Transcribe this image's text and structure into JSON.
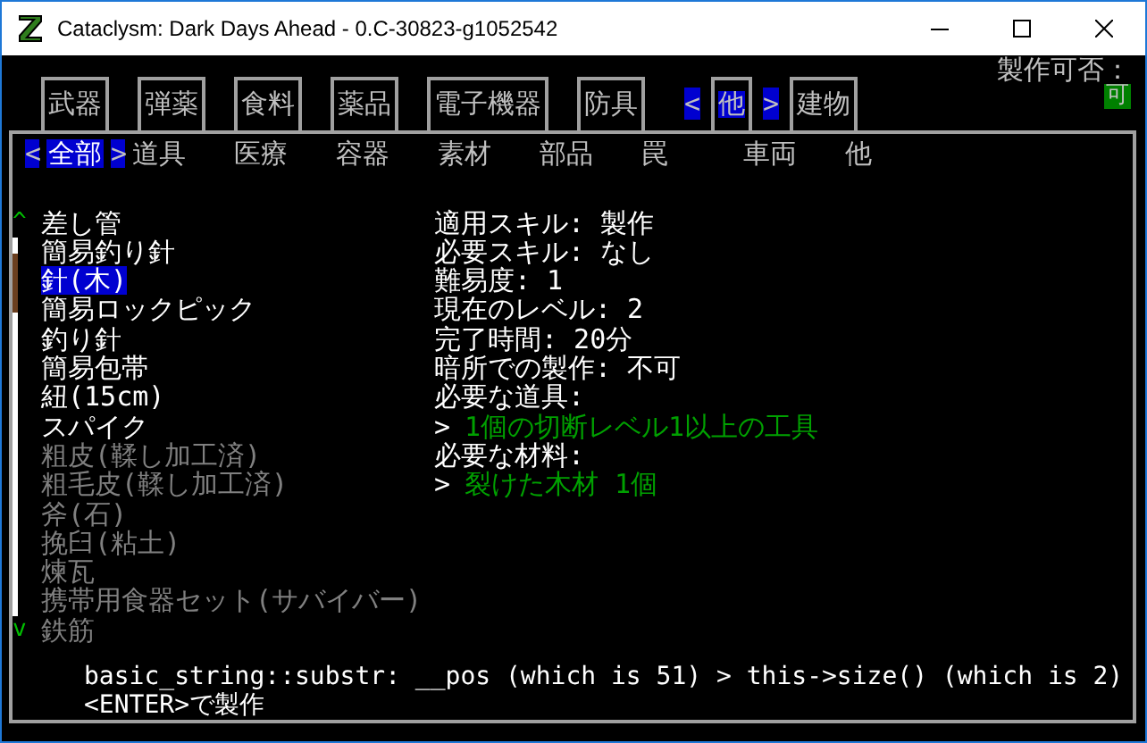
{
  "window": {
    "title": "Cataclysm: Dark Days Ahead - 0.C-30823-g1052542"
  },
  "tabs": {
    "left_arrow": "<",
    "right_arrow": ">",
    "items": [
      {
        "label": "武器",
        "selected": false
      },
      {
        "label": "弾薬",
        "selected": false
      },
      {
        "label": "食料",
        "selected": false
      },
      {
        "label": "薬品",
        "selected": false
      },
      {
        "label": "電子機器",
        "selected": false
      },
      {
        "label": "防具",
        "selected": false
      },
      {
        "label": "他",
        "selected": true
      },
      {
        "label": "建物",
        "selected": false
      }
    ]
  },
  "craft_status": {
    "label": "製作可否：",
    "value": "可"
  },
  "subtabs": {
    "left_arrow": "<",
    "right_arrow": ">",
    "items": [
      {
        "label": "全部",
        "selected": true
      },
      {
        "label": "道具",
        "selected": false
      },
      {
        "label": "医療",
        "selected": false
      },
      {
        "label": "容器",
        "selected": false
      },
      {
        "label": "素材",
        "selected": false
      },
      {
        "label": "部品",
        "selected": false
      },
      {
        "label": "罠",
        "selected": false
      },
      {
        "label": "車両",
        "selected": false
      },
      {
        "label": "他",
        "selected": false
      }
    ]
  },
  "scroll": {
    "up": "^",
    "down": "v"
  },
  "recipes": [
    {
      "name": "差し管",
      "available": true,
      "selected": false
    },
    {
      "name": "簡易釣り針",
      "available": true,
      "selected": false
    },
    {
      "name": "針(木)",
      "available": true,
      "selected": true
    },
    {
      "name": "簡易ロックピック",
      "available": true,
      "selected": false
    },
    {
      "name": "釣り針",
      "available": true,
      "selected": false
    },
    {
      "name": "簡易包帯",
      "available": true,
      "selected": false
    },
    {
      "name": "紐(15cm)",
      "available": true,
      "selected": false
    },
    {
      "name": "スパイク",
      "available": true,
      "selected": false
    },
    {
      "name": "粗皮(鞣し加工済)",
      "available": false,
      "selected": false
    },
    {
      "name": "粗毛皮(鞣し加工済)",
      "available": false,
      "selected": false
    },
    {
      "name": "斧(石)",
      "available": false,
      "selected": false
    },
    {
      "name": "挽臼(粘土)",
      "available": false,
      "selected": false
    },
    {
      "name": "煉瓦",
      "available": false,
      "selected": false
    },
    {
      "name": "携帯用食器セット(サバイバー)",
      "available": false,
      "selected": false
    },
    {
      "name": "鉄筋",
      "available": false,
      "selected": false
    }
  ],
  "details": [
    {
      "kind": "text",
      "text": "適用スキル: 製作"
    },
    {
      "kind": "text",
      "text": "必要スキル: なし"
    },
    {
      "kind": "text",
      "text": "難易度: 1"
    },
    {
      "kind": "text",
      "text": "現在のレベル: 2"
    },
    {
      "kind": "text",
      "text": "完了時間: 20分"
    },
    {
      "kind": "text",
      "text": "暗所での製作: 不可"
    },
    {
      "kind": "text",
      "text": "必要な道具:"
    },
    {
      "kind": "requirement",
      "marker": ">",
      "text": "1個の切断レベル1以上の工具"
    },
    {
      "kind": "text",
      "text": "必要な材料:"
    },
    {
      "kind": "requirement",
      "marker": ">",
      "text": "裂けた木材 1個"
    }
  ],
  "messages": [
    "basic_string::substr: __pos (which is 51) > this->size() (which is 2)",
    "<ENTER>で製作"
  ]
}
